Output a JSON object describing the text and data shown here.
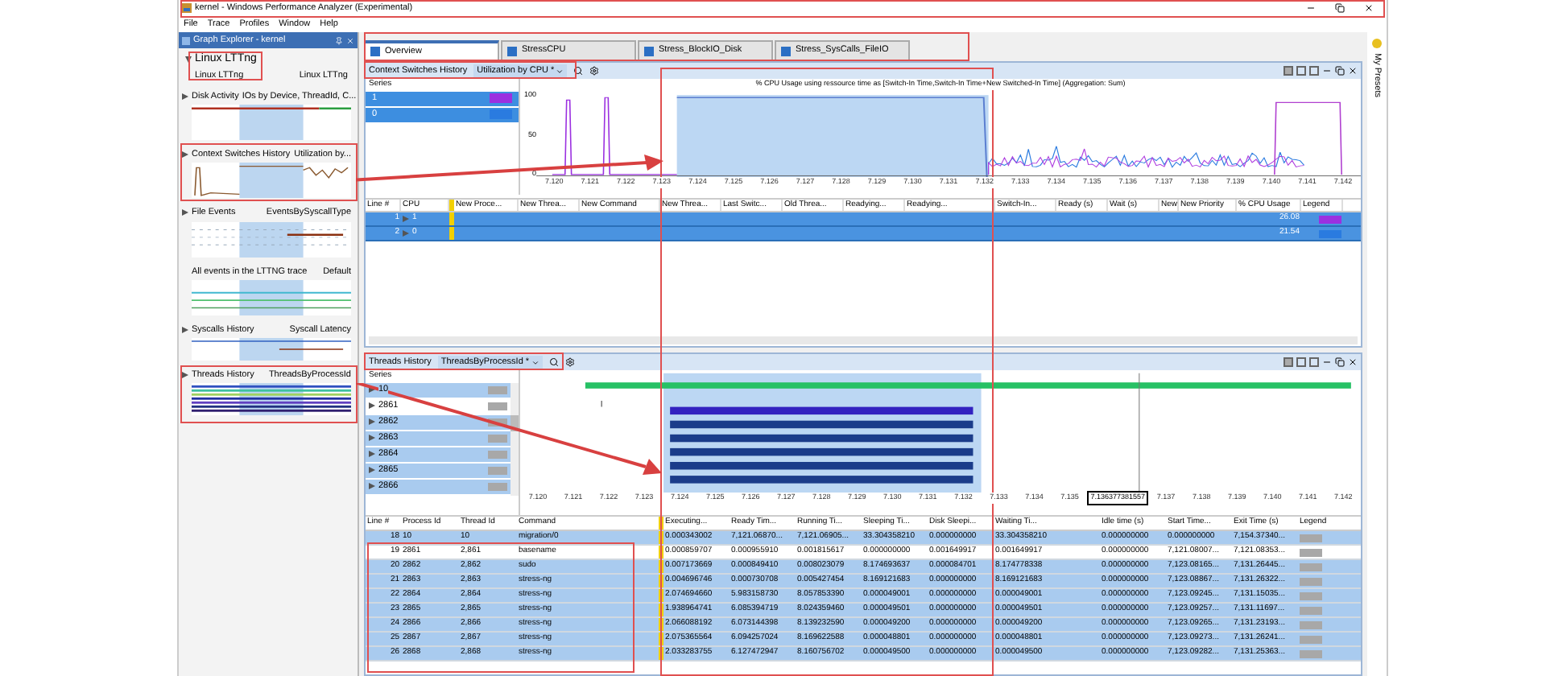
{
  "window": {
    "title": "kernel - Windows Performance Analyzer (Experimental)"
  },
  "menu": [
    "File",
    "Trace",
    "Profiles",
    "Window",
    "Help"
  ],
  "graph_explorer": {
    "title": "Graph Explorer - kernel",
    "group": {
      "title": "Linux LTTng",
      "name": "Linux LTTng",
      "preset": "Linux LTTng",
      "expanded": true
    },
    "items": [
      {
        "name": "Disk Activity",
        "preset": "IOs by Device, ThreadId, C...",
        "kind": "disk",
        "expandable": true
      },
      {
        "name": "Context Switches History",
        "preset": "Utilization by...",
        "kind": "context",
        "expandable": true
      },
      {
        "name": "File Events",
        "preset": "EventsBySyscallType",
        "kind": "file",
        "expandable": true
      },
      {
        "name": "All events in the LTTNG trace",
        "preset": "Default",
        "kind": "events",
        "expandable": false
      },
      {
        "name": "Syscalls History",
        "preset": "Syscall Latency",
        "kind": "syscalls",
        "expandable": true
      },
      {
        "name": "Threads History",
        "preset": "ThreadsByProcessId",
        "kind": "threads",
        "expandable": true
      }
    ]
  },
  "tabs": [
    {
      "label": "Overview",
      "selected": true
    },
    {
      "label": "StressCPU",
      "selected": false
    },
    {
      "label": "Stress_BlockIO_Disk",
      "selected": false
    },
    {
      "label": "Stress_SysCalls_FileIO",
      "selected": false
    }
  ],
  "context_panel": {
    "title": "Context Switches History",
    "preset": "Utilization by CPU *",
    "series_label": "Series",
    "series": [
      {
        "name": "1",
        "selected": true,
        "color": "#9b30e0"
      },
      {
        "name": "0",
        "selected": true,
        "color": "#2a7be0"
      }
    ],
    "graph_title": "% CPU Usage using ressource time as [Switch-In Time,Switch-In Time+New Switched-In Time] (Aggregation: Sum)",
    "yticks": [
      "100",
      "50",
      "0"
    ],
    "xticks": [
      "7.120",
      "7.121",
      "7.122",
      "7.123",
      "7.124",
      "7.125",
      "7.126",
      "7.127",
      "7.128",
      "7.129",
      "7.130",
      "7.131",
      "7.132",
      "7.133",
      "7.134",
      "7.135",
      "7.136",
      "7.137",
      "7.138",
      "7.139",
      "7.140",
      "7.141",
      "7.142"
    ],
    "table": {
      "columns": [
        "Line #",
        "CPU",
        "New Proce...",
        "New Threa...",
        "New Command",
        "New Threa...",
        "Last Switc...",
        "Old Threa...",
        "Readying...",
        "Readying...",
        "Switch-In...",
        "Ready (s)",
        "Wait (s)",
        "New",
        "New Priority",
        "% CPU Usage",
        "Legend"
      ],
      "rows": [
        {
          "selected": true,
          "line": "1",
          "cpu": "1",
          "cpu_usage": "26.08",
          "color": "#9b30e0"
        },
        {
          "selected": true,
          "line": "2",
          "cpu": "0",
          "cpu_usage": "21.54",
          "color": "#2a7be0"
        }
      ]
    }
  },
  "threads_panel": {
    "title": "Threads History",
    "preset": "ThreadsByProcessId *",
    "series_label": "Series",
    "series": [
      {
        "name": "10",
        "selected": true
      },
      {
        "name": "2861",
        "selected": false
      },
      {
        "name": "2862",
        "selected": true
      },
      {
        "name": "2863",
        "selected": true
      },
      {
        "name": "2864",
        "selected": true
      },
      {
        "name": "2865",
        "selected": true
      },
      {
        "name": "2866",
        "selected": true
      }
    ],
    "xticks": [
      "7.120",
      "7.121",
      "7.122",
      "7.123",
      "7.124",
      "7.125",
      "7.126",
      "7.127",
      "7.128",
      "7.129",
      "7.130",
      "7.131",
      "7.132",
      "7.133",
      "7.134",
      "7.135",
      "7.137",
      "7.138",
      "7.139",
      "7.140",
      "7.141",
      "7.142"
    ],
    "cursor_label": "7.136377381557",
    "table": {
      "columns": [
        "Line #",
        "Process Id",
        "Thread Id",
        "Command",
        "Executing...",
        "Ready Tim...",
        "Running Ti...",
        "Sleeping Ti...",
        "Disk Sleepi...",
        "Waiting Ti...",
        "Idle time (s)",
        "Start Time...",
        "Exit Time (s)",
        "Legend"
      ],
      "rows": [
        {
          "selected": true,
          "cells": [
            "18",
            "10",
            "10",
            "migration/0",
            "0.000343002",
            "7,121.06870...",
            "7,121.06905...",
            "33.304358210",
            "0.000000000",
            "33.304358210",
            "0.000000000",
            "0.000000000",
            "7,154.37340..."
          ]
        },
        {
          "selected": false,
          "cells": [
            "19",
            "2861",
            "2,861",
            "basename",
            "0.000859707",
            "0.000955910",
            "0.001815617",
            "0.000000000",
            "0.001649917",
            "0.001649917",
            "0.000000000",
            "7,121.08007...",
            "7,121.08353..."
          ]
        },
        {
          "selected": true,
          "cells": [
            "20",
            "2862",
            "2,862",
            "sudo",
            "0.007173669",
            "0.000849410",
            "0.008023079",
            "8.174693637",
            "0.000084701",
            "8.174778338",
            "0.000000000",
            "7,123.08165...",
            "7,131.26445..."
          ]
        },
        {
          "selected": true,
          "cells": [
            "21",
            "2863",
            "2,863",
            "stress-ng",
            "0.004696746",
            "0.000730708",
            "0.005427454",
            "8.169121683",
            "0.000000000",
            "8.169121683",
            "0.000000000",
            "7,123.08867...",
            "7,131.26322..."
          ]
        },
        {
          "selected": true,
          "cells": [
            "22",
            "2864",
            "2,864",
            "stress-ng",
            "2.074694660",
            "5.983158730",
            "8.057853390",
            "0.000049001",
            "0.000000000",
            "0.000049001",
            "0.000000000",
            "7,123.09245...",
            "7,131.15035..."
          ]
        },
        {
          "selected": true,
          "cells": [
            "23",
            "2865",
            "2,865",
            "stress-ng",
            "1.938964741",
            "6.085394719",
            "8.024359460",
            "0.000049501",
            "0.000000000",
            "0.000049501",
            "0.000000000",
            "7,123.09257...",
            "7,131.11697..."
          ]
        },
        {
          "selected": true,
          "cells": [
            "24",
            "2866",
            "2,866",
            "stress-ng",
            "2.066088192",
            "6.073144398",
            "8.139232590",
            "0.000049200",
            "0.000000000",
            "0.000049200",
            "0.000000000",
            "7,123.09265...",
            "7,131.23193..."
          ]
        },
        {
          "selected": true,
          "cells": [
            "25",
            "2867",
            "2,867",
            "stress-ng",
            "2.075365564",
            "6.094257024",
            "8.169622588",
            "0.000048801",
            "0.000000000",
            "0.000048801",
            "0.000000000",
            "7,123.09273...",
            "7,131.26241..."
          ]
        },
        {
          "selected": true,
          "cells": [
            "26",
            "2868",
            "2,868",
            "stress-ng",
            "2.033283755",
            "6.127472947",
            "8.160756702",
            "0.000049500",
            "0.000000000",
            "0.000049500",
            "0.000000000",
            "7,123.09282...",
            "7,131.25363..."
          ]
        }
      ]
    }
  },
  "side_strip": {
    "label": "My Presets"
  }
}
